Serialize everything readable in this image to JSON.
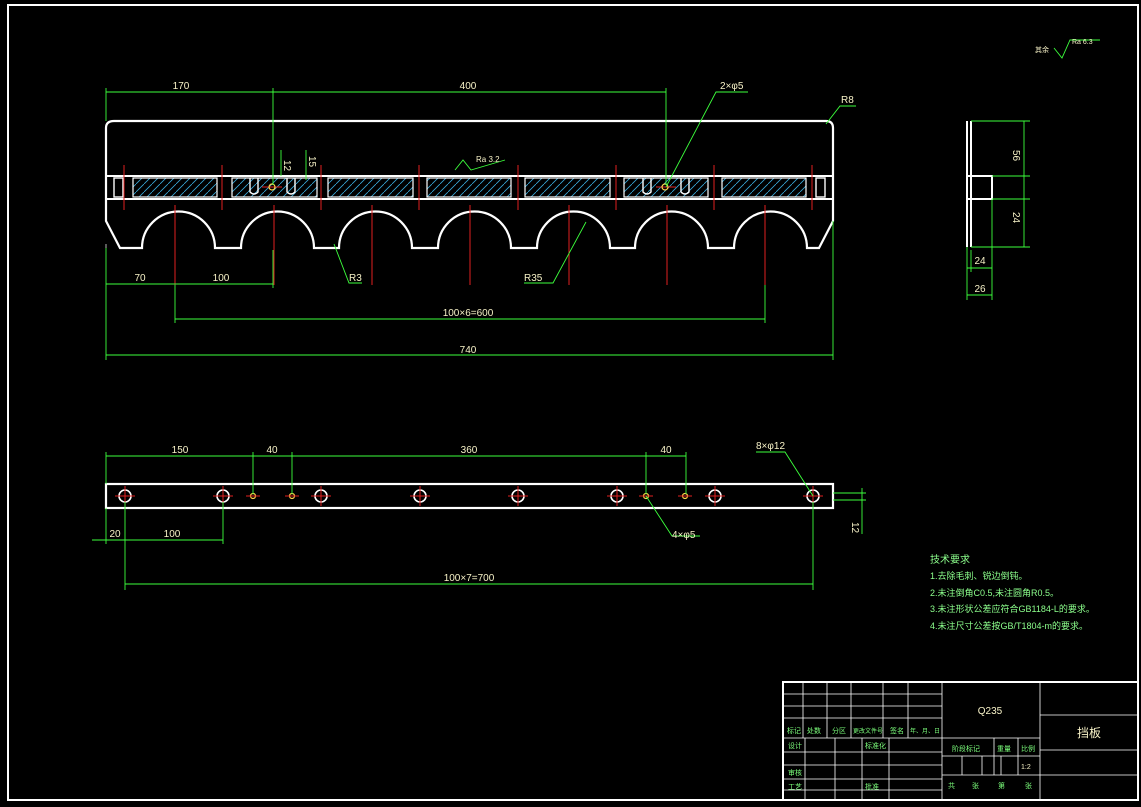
{
  "drawing": {
    "front_view": {
      "dims": {
        "d170": "170",
        "d400": "400",
        "d2x5": "2×φ5",
        "r8": "R8",
        "d12": "12",
        "d15": "15",
        "ra32": "Ra 3.2",
        "d70": "70",
        "d100": "100",
        "r3": "R3",
        "r35": "R35",
        "d100x6": "100×6=600",
        "d740": "740"
      }
    },
    "side_view": {
      "dims": {
        "d56": "56",
        "d24v": "24",
        "d24h": "24",
        "d26": "26"
      }
    },
    "top_view": {
      "dims": {
        "d150": "150",
        "d40a": "40",
        "d360": "360",
        "d40b": "40",
        "d8x12": "8×φ12",
        "d20": "20",
        "d100": "100",
        "d4x5": "4×φ5",
        "d12": "12",
        "d100x7": "100×7=700"
      }
    },
    "roughness_note": {
      "prefix": "其余",
      "value": "Ra 6.3"
    }
  },
  "technical_requirements": {
    "title": "技术要求",
    "items": [
      "1.去除毛刺、锐边倒钝。",
      "2.未注倒角C0.5,未注圆角R0.5。",
      "3.未注形状公差应符合GB1184-L的要求。",
      "4.未注尺寸公差按GB/T1804-m的要求。"
    ]
  },
  "title_block": {
    "material": "Q235",
    "part_name": "挡板",
    "scale_label": "比例",
    "scale": "1:2",
    "weight_label": "重量",
    "stage_label": "阶段标记",
    "sheet_row": [
      "共",
      "张",
      "第",
      "张"
    ],
    "rev_header": [
      "标记",
      "处数",
      "分区",
      "更改文件号",
      "签名",
      "年、月、日"
    ],
    "roles": [
      "设计",
      "标准化",
      "审核",
      "工艺",
      "批准"
    ]
  }
}
